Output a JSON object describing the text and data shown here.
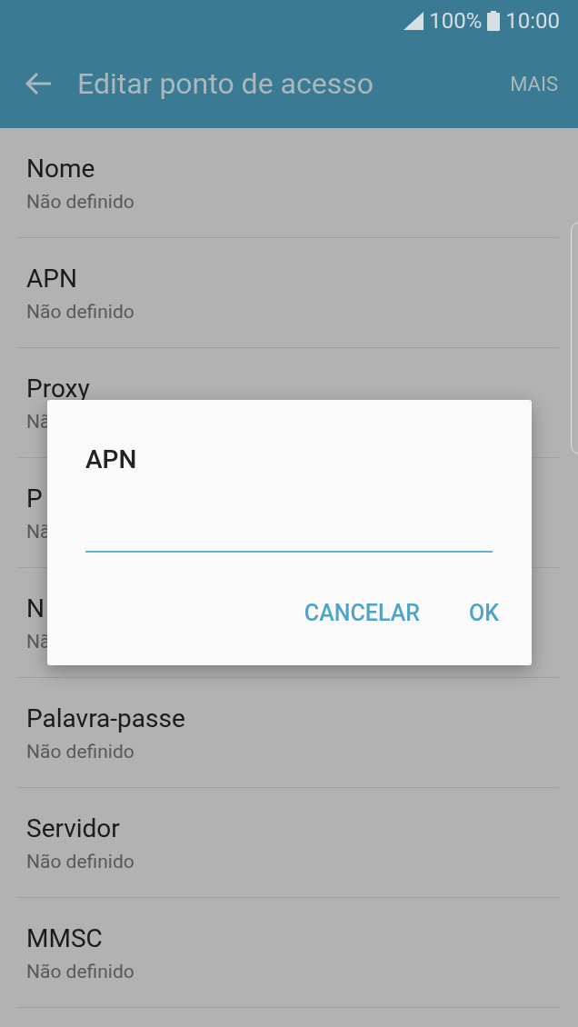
{
  "status_bar": {
    "battery": "100%",
    "time": "10:00"
  },
  "app_bar": {
    "title": "Editar ponto de acesso",
    "menu": "MAIS"
  },
  "rows": [
    {
      "title": "Nome",
      "subtitle": "Não definido"
    },
    {
      "title": "APN",
      "subtitle": "Não definido"
    },
    {
      "title": "Proxy",
      "subtitle": "Nã"
    },
    {
      "title": "P",
      "subtitle": "Nã"
    },
    {
      "title": "N",
      "subtitle": "Nã"
    },
    {
      "title": "Palavra-passe",
      "subtitle": "Não definido"
    },
    {
      "title": "Servidor",
      "subtitle": "Não definido"
    },
    {
      "title": "MMSC",
      "subtitle": "Não definido"
    }
  ],
  "dialog": {
    "title": "APN",
    "buttons": [
      "CANCELAR",
      "OK"
    ]
  }
}
